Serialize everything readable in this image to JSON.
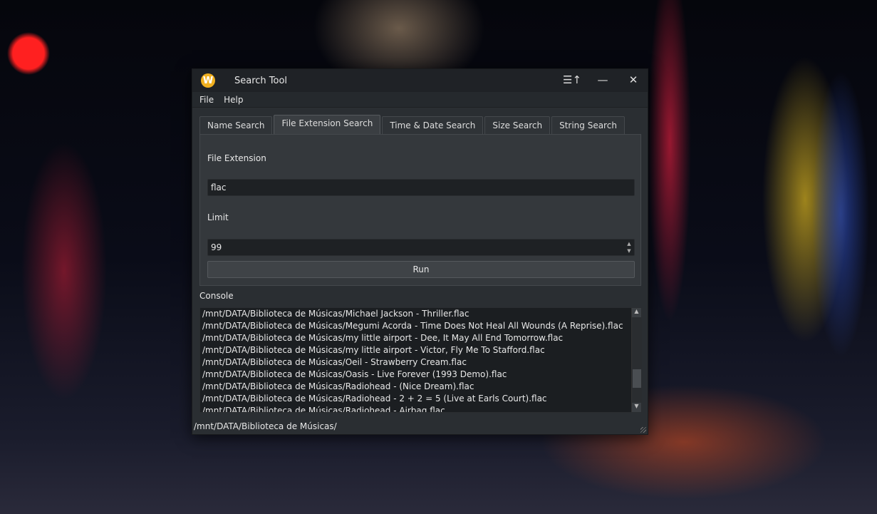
{
  "window": {
    "title": "Search Tool",
    "logo_letter": "W"
  },
  "menu": [
    "File",
    "Help"
  ],
  "tabs": [
    "Name Search",
    "File Extension Search",
    "Time & Date Search",
    "Size Search",
    "String Search"
  ],
  "active_tab": 1,
  "form": {
    "extension_label": "File Extension",
    "extension_value": "flac",
    "limit_label": "Limit",
    "limit_value": "99",
    "run_label": "Run"
  },
  "console": {
    "label": "Console",
    "lines": [
      "/mnt/DATA/Biblioteca de Músicas/Michael Jackson - Thriller.flac",
      "/mnt/DATA/Biblioteca de Músicas/Megumi Acorda - Time Does Not Heal All Wounds (A Reprise).flac",
      "/mnt/DATA/Biblioteca de Músicas/my little airport - Dee, It May All End Tomorrow.flac",
      "/mnt/DATA/Biblioteca de Músicas/my little airport - Victor, Fly Me To Stafford.flac",
      "/mnt/DATA/Biblioteca de Músicas/Oeil - Strawberry Cream.flac",
      "/mnt/DATA/Biblioteca de Músicas/Oasis - Live Forever (1993 Demo).flac",
      "/mnt/DATA/Biblioteca de Músicas/Radiohead - (Nice Dream).flac",
      "/mnt/DATA/Biblioteca de Músicas/Radiohead - 2 + 2 = 5 (Live at Earls Court).flac",
      "/mnt/DATA/Biblioteca de Músicas/Radiohead - Airbag.flac"
    ]
  },
  "status": "/mnt/DATA/Biblioteca de Músicas/"
}
